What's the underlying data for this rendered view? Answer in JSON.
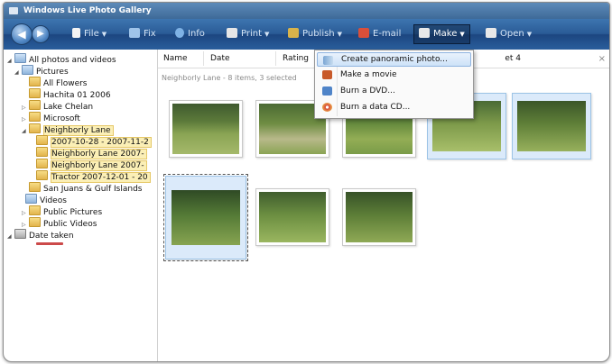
{
  "window": {
    "title": "Windows Live Photo Gallery"
  },
  "toolbar": {
    "file": "File",
    "fix": "Fix",
    "info": "Info",
    "print": "Print",
    "publish": "Publish",
    "email": "E-mail",
    "make": "Make",
    "open": "Open"
  },
  "tree": {
    "all": "All photos and videos",
    "pictures": "Pictures",
    "all_flowers": "All Flowers",
    "hachita": "Hachita 01 2006",
    "lake_chelan": "Lake Chelan",
    "microsoft": "Microsoft",
    "neighborly_lane": "Neighborly Lane",
    "sub1": "2007-10-28 - 2007-11-2",
    "sub2": "Neighborly Lane 2007-",
    "sub3": "Neighborly Lane 2007-",
    "sub4": "Tractor 2007-12-01 - 20",
    "san_juans": "San Juans & Gulf Islands",
    "videos": "Videos",
    "public_pictures": "Public Pictures",
    "public_videos": "Public Videos",
    "date_taken": "Date taken"
  },
  "columns": {
    "name": "Name",
    "date": "Date",
    "rating": "Rating",
    "search_fragment": "et 4"
  },
  "status": "Neighborly Lane - 8 items, 3 selected",
  "make_menu": {
    "panoramic": "Create panoramic photo...",
    "movie": "Make a movie",
    "dvd": "Burn a DVD...",
    "cd": "Burn a data CD..."
  },
  "icons": {
    "close": "×"
  }
}
